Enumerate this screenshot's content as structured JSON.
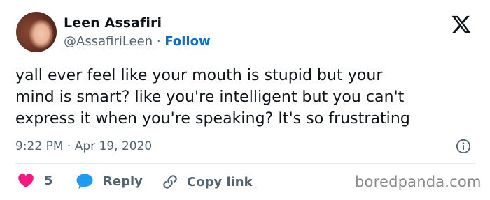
{
  "tweet": {
    "author_name": "Leen Assafiri",
    "handle": "@AssafiriLeen",
    "separator": "·",
    "follow_label": "Follow",
    "text_lines": [
      "yall ever feel like your mouth is stupid but your",
      "mind is smart? like you're intelligent but you can't",
      "express it when you're speaking? It's so frustrating"
    ],
    "time": "9:22 PM",
    "date_separator": "·",
    "date": "Apr 19, 2020"
  },
  "actions": {
    "like_count": "5",
    "reply_label": "Reply",
    "copy_label": "Copy link"
  },
  "watermark": "boredpanda.com",
  "icons": {
    "brand": "x-logo-icon",
    "info": "info-icon",
    "like": "heart-icon",
    "reply": "speech-bubble-icon",
    "copy": "link-icon"
  },
  "colors": {
    "like": "#f91880",
    "reply": "#1d9bf0",
    "follow": "#006fd6",
    "muted": "#536471"
  }
}
